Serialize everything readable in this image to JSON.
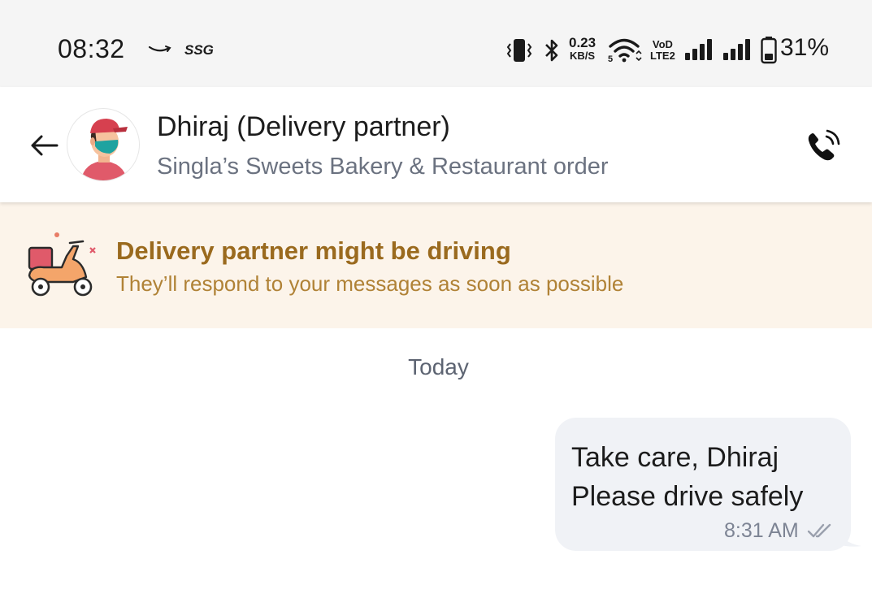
{
  "status_bar": {
    "time": "08:32",
    "carrier_badge": "SSG",
    "net_speed": "0.23",
    "net_speed_unit": "KB/S",
    "volte_top": "VoD",
    "volte_bottom": "LTE2",
    "battery": "31%",
    "icons": [
      "amazon-smile-icon",
      "vibrate-icon",
      "bluetooth-icon",
      "wifi-icon",
      "signal-icon",
      "signal-icon",
      "battery-icon"
    ]
  },
  "header": {
    "name": "Dhiraj (Delivery partner)",
    "subtitle": "Singla’s Sweets Bakery & Restaurant order",
    "icons": [
      "back-arrow-icon",
      "delivery-partner-avatar",
      "phone-call-icon"
    ]
  },
  "banner": {
    "title": "Delivery partner might be driving",
    "subtitle": "They’ll respond to your messages as soon as possible",
    "icon": "scooter-icon",
    "colors": {
      "background": "#fcf4ea",
      "title": "#9a6a1e",
      "subtitle": "#b08236"
    }
  },
  "messages": {
    "date_label": "Today",
    "items": [
      {
        "direction": "outgoing",
        "lines": [
          "Take care, Dhiraj",
          "Please drive safely"
        ],
        "time": "8:31 AM",
        "status_icon": "double-check-icon"
      }
    ]
  }
}
